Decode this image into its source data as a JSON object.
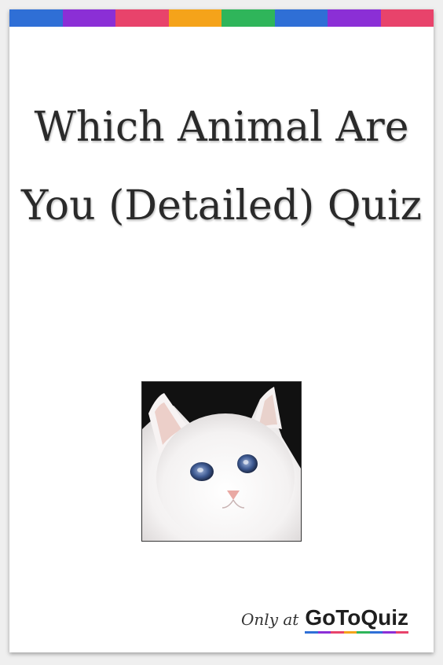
{
  "title": "Which Animal Are You (Detailed) Quiz",
  "brand": {
    "prefix": "Only at",
    "name": "GoToQuiz"
  },
  "stripe_colors": [
    "#2f6fd6",
    "#8b2fd6",
    "#e8436b",
    "#f5a31a",
    "#2fb55a",
    "#2f6fd6",
    "#8b2fd6",
    "#e8436b"
  ],
  "image": {
    "icon": "white-cat-photo"
  }
}
